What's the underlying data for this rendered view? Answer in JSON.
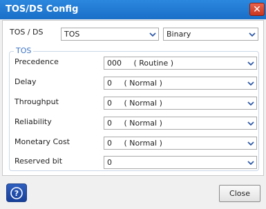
{
  "window": {
    "title": "TOS/DS Config",
    "close_glyph": "✕"
  },
  "tosds": {
    "label": "TOS / DS",
    "mode_value": "TOS",
    "format_value": "Binary"
  },
  "group": {
    "title": "TOS"
  },
  "fields": [
    {
      "label": "Precedence",
      "value": "000",
      "desc": "( Routine )"
    },
    {
      "label": "Delay",
      "value": "0",
      "desc": "( Normal )"
    },
    {
      "label": "Throughput",
      "value": "0",
      "desc": "( Normal )"
    },
    {
      "label": "Reliability",
      "value": "0",
      "desc": "( Normal )"
    },
    {
      "label": "Monetary Cost",
      "value": "0",
      "desc": "( Normal )"
    },
    {
      "label": "Reserved bit",
      "value": "0",
      "desc": ""
    }
  ],
  "footer": {
    "help_glyph": "?",
    "close_label": "Close"
  },
  "colors": {
    "title_bar": "#1f7ad3",
    "group_title": "#3b73c5",
    "chevron": "#2f5aa8"
  },
  "icons": {
    "dropdown": "chevron-down-icon",
    "help": "help-icon",
    "close": "close-icon"
  }
}
